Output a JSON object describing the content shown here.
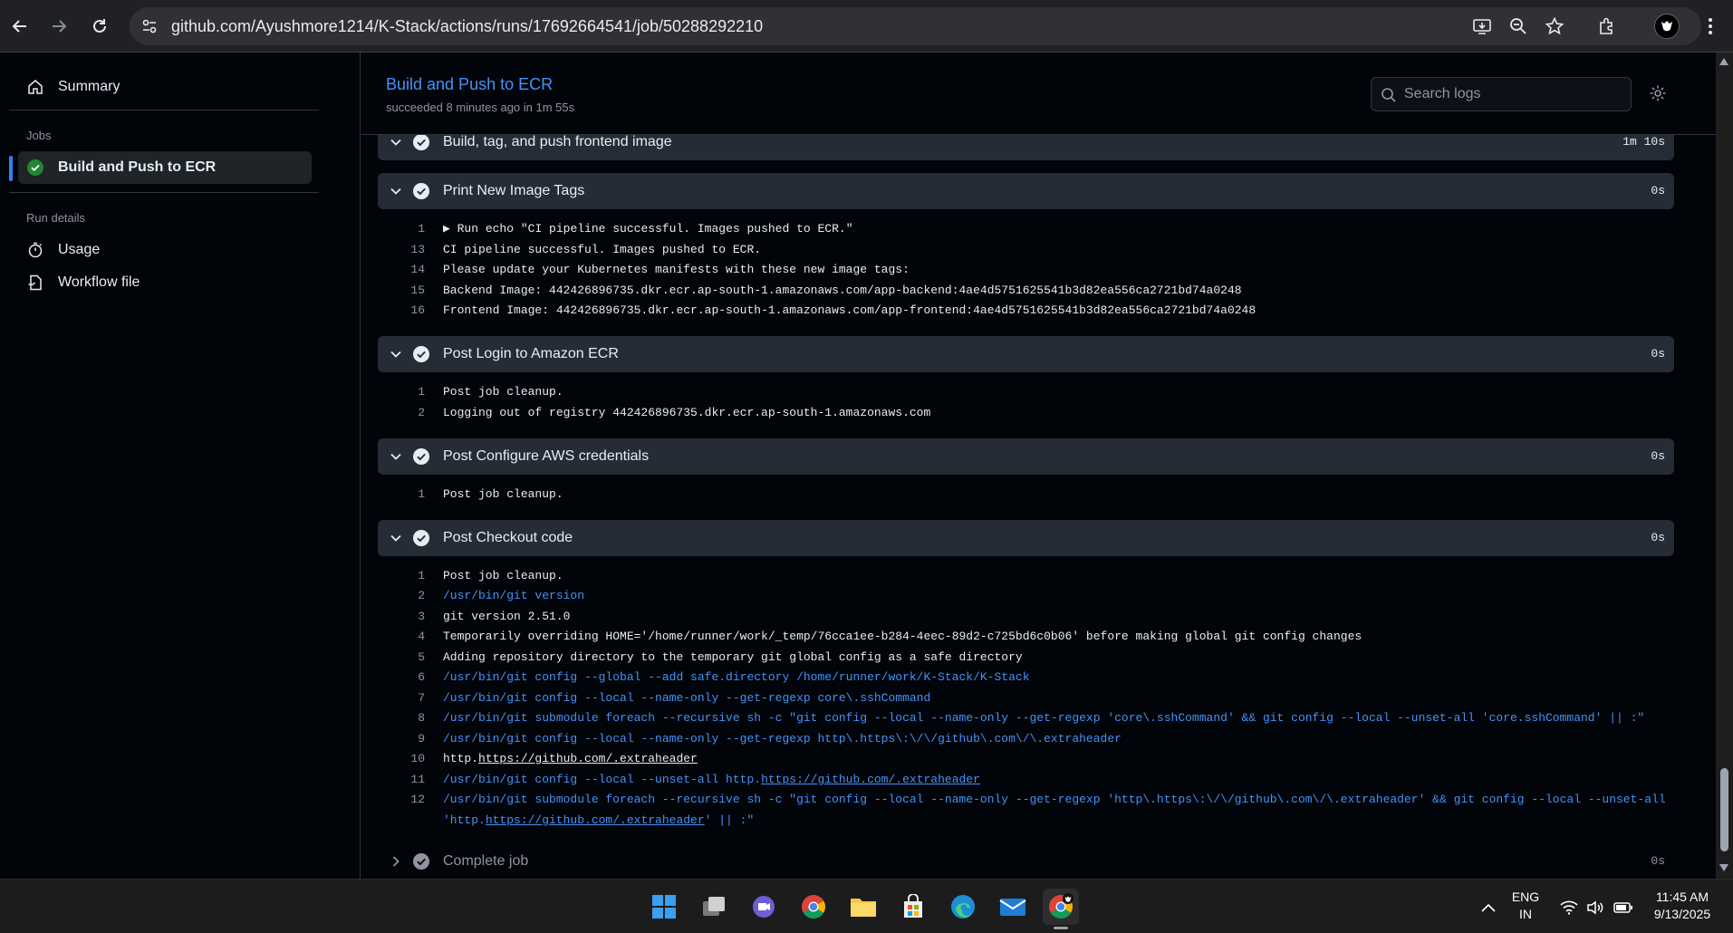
{
  "browser": {
    "url": "github.com/Ayushmore1214/K-Stack/actions/runs/17692664541/job/50288292210"
  },
  "sidebar": {
    "summary_label": "Summary",
    "jobs_heading": "Jobs",
    "selected_job_label": "Build and Push to ECR",
    "run_details_heading": "Run details",
    "usage_label": "Usage",
    "workflow_file_label": "Workflow file"
  },
  "header": {
    "title": "Build and Push to ECR",
    "subtitle": "succeeded 8 minutes ago in 1m 55s",
    "search_placeholder": "Search logs"
  },
  "steps": [
    {
      "name": "Build, tag, and push frontend image",
      "duration": "1m 10s"
    },
    {
      "name": "Print New Image Tags",
      "duration": "0s",
      "lines": [
        {
          "n": "1",
          "text": "▶ Run echo \"CI pipeline successful. Images pushed to ECR.\""
        },
        {
          "n": "13",
          "text": "CI pipeline successful. Images pushed to ECR."
        },
        {
          "n": "14",
          "text": "Please update your Kubernetes manifests with these new image tags:"
        },
        {
          "n": "15",
          "text": "Backend Image: 442426896735.dkr.ecr.ap-south-1.amazonaws.com/app-backend:4ae4d5751625541b3d82ea556ca2721bd74a0248"
        },
        {
          "n": "16",
          "text": "Frontend Image: 442426896735.dkr.ecr.ap-south-1.amazonaws.com/app-frontend:4ae4d5751625541b3d82ea556ca2721bd74a0248"
        }
      ]
    },
    {
      "name": "Post Login to Amazon ECR",
      "duration": "0s",
      "lines": [
        {
          "n": "1",
          "text": "Post job cleanup."
        },
        {
          "n": "2",
          "text": "Logging out of registry 442426896735.dkr.ecr.ap-south-1.amazonaws.com"
        }
      ]
    },
    {
      "name": "Post Configure AWS credentials",
      "duration": "0s",
      "lines": [
        {
          "n": "1",
          "text": "Post job cleanup."
        }
      ]
    },
    {
      "name": "Post Checkout code",
      "duration": "0s",
      "lines": [
        {
          "n": "1",
          "text": "Post job cleanup."
        },
        {
          "n": "2",
          "text": "/usr/bin/git version"
        },
        {
          "n": "3",
          "text": "git version 2.51.0"
        },
        {
          "n": "4",
          "text": "Temporarily overriding HOME='/home/runner/work/_temp/76cca1ee-b284-4eec-89d2-c725bd6c0b06' before making global git config changes"
        },
        {
          "n": "5",
          "text": "Adding repository directory to the temporary git global config as a safe directory"
        },
        {
          "n": "6",
          "text": "/usr/bin/git config --global --add safe.directory /home/runner/work/K-Stack/K-Stack"
        },
        {
          "n": "7",
          "text": "/usr/bin/git config --local --name-only --get-regexp core\\.sshCommand"
        },
        {
          "n": "8",
          "text": "/usr/bin/git submodule foreach --recursive sh -c \"git config --local --name-only --get-regexp 'core\\.sshCommand' && git config --local --unset-all 'core.sshCommand' || :\""
        },
        {
          "n": "9",
          "text": "/usr/bin/git config --local --name-only --get-regexp http\\.https\\:\\/\\/github\\.com\\/\\.extraheader"
        },
        {
          "n": "10",
          "prefix": "http.",
          "link": "https://github.com/.extraheader"
        },
        {
          "n": "11",
          "prefix": "/usr/bin/git config --local --unset-all http.",
          "link": "https://github.com/.extraheader"
        },
        {
          "n": "12",
          "text": "/usr/bin/git submodule foreach --recursive sh -c \"git config --local --name-only --get-regexp 'http\\.https\\:\\/\\/github\\.com\\/\\.extraheader' && git config --local --unset-all"
        },
        {
          "n": "",
          "prefix": "'http.",
          "link": "https://github.com/.extraheader",
          "suffix": "' || :\""
        }
      ]
    },
    {
      "name": "Complete job",
      "duration": "0s"
    }
  ],
  "taskbar": {
    "language_primary": "ENG",
    "language_secondary": "IN",
    "time": "11:45 AM",
    "date": "9/13/2025"
  },
  "colors": {
    "accent_blue": "#4493f8",
    "success_green": "#238636",
    "step_header_bg": "#262c36",
    "page_bg": "#010409"
  }
}
